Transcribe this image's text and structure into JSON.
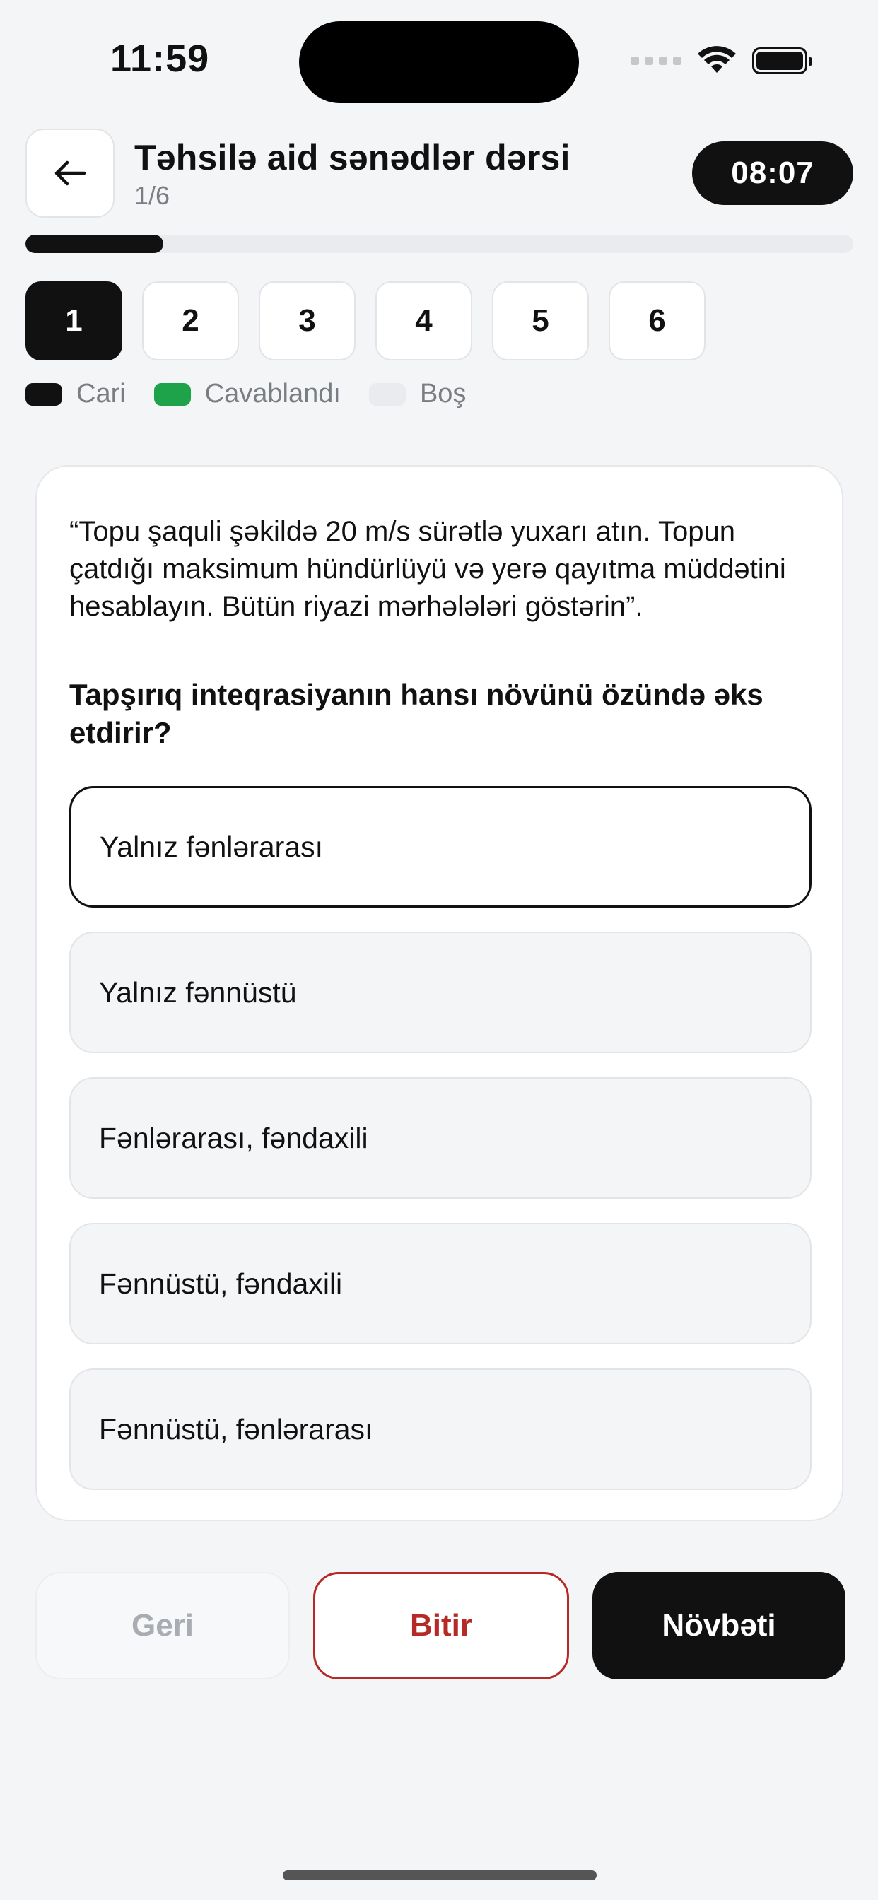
{
  "status_bar": {
    "time": "11:59"
  },
  "header": {
    "title": "Təhsilə aid sənədlər dərsi",
    "subtitle": "1/6",
    "timer": "08:07"
  },
  "progress": {
    "current": 1,
    "total": 6,
    "fraction": 0.1667
  },
  "question_numbers": [
    "1",
    "2",
    "3",
    "4",
    "5",
    "6"
  ],
  "current_question": 1,
  "legend": [
    {
      "label": "Cari",
      "color": "#111111"
    },
    {
      "label": "Cavablandı",
      "color": "#1fa34a"
    },
    {
      "label": "Boş",
      "color": "#e9ebee"
    }
  ],
  "question": {
    "text": "“Topu şaquli şəkildə 20 m/s sürətlə yuxarı atın. Topun çatdığı maksimum hündürlüyü və yerə qayıtma müddətini hesablayın. Bütün riyazi mərhələləri göstərin”.",
    "prompt": "Tapşırıq inteqrasiyanın hansı növünü özündə əks etdirir?",
    "options": [
      {
        "label": "Yalnız fənlərarası",
        "selected": true
      },
      {
        "label": "Yalnız fənnüstü",
        "selected": false
      },
      {
        "label": "Fənlərarası, fəndaxili",
        "selected": false
      },
      {
        "label": "Fənnüstü, fəndaxili",
        "selected": false
      },
      {
        "label": "Fənnüstü, fənlərarası",
        "selected": false
      }
    ]
  },
  "buttons": {
    "back": "Geri",
    "finish": "Bitir",
    "next": "Növbəti"
  },
  "icons": {
    "back": "arrow-left-icon",
    "wifi": "wifi-icon",
    "battery": "battery-icon",
    "signal": "signal-icon"
  },
  "colors": {
    "accent": "#111111",
    "answered": "#1fa34a",
    "danger": "#b52a26"
  }
}
